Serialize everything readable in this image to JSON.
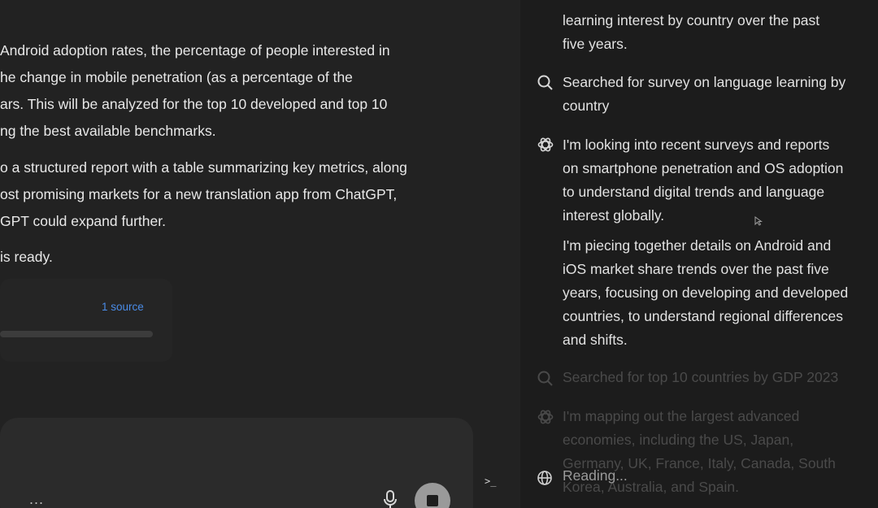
{
  "chat": {
    "paragraphs": [
      {
        "lines": [
          " Android adoption rates, the percentage of people interested in",
          "he change in mobile penetration (as a percentage of the",
          "ars. This will be analyzed for the top 10 developed and top 10",
          "ng the best available benchmarks."
        ]
      },
      {
        "lines": [
          "o a structured report with a table summarizing key metrics, along",
          "ost promising markets for a new translation app from ChatGPT,",
          "GPT could expand further."
        ]
      },
      {
        "lines": [
          "is ready."
        ]
      }
    ],
    "source_link": "1 source",
    "more_label": "...",
    "terminal_label": ">_"
  },
  "activity": {
    "top_text": [
      "learning interest by country over the past",
      "five years."
    ],
    "search1": [
      "Searched for survey on language learning by",
      "country"
    ],
    "think1": [
      "I'm looking into recent surveys and reports",
      "on smartphone penetration and OS adoption",
      "to understand digital trends and language",
      "interest globally."
    ],
    "think2": [
      "I'm piecing together details on Android and",
      "iOS market share trends over the past five",
      "years, focusing on developing and developed",
      "countries, to understand regional differences",
      "and shifts."
    ],
    "search2": [
      "Searched for top 10 countries by GDP 2023"
    ],
    "think3": [
      "I'm mapping out the largest advanced",
      "economies, including the US, Japan,",
      "Germany, UK, France, Italy, Canada, South",
      "Korea, Australia, and Spain."
    ],
    "reading_label": "Reading..."
  },
  "icons": {
    "search": "search-icon",
    "thinking": "openai-logo-icon",
    "reading": "globe-icon",
    "mic": "microphone-icon",
    "stop": "stop-icon"
  }
}
